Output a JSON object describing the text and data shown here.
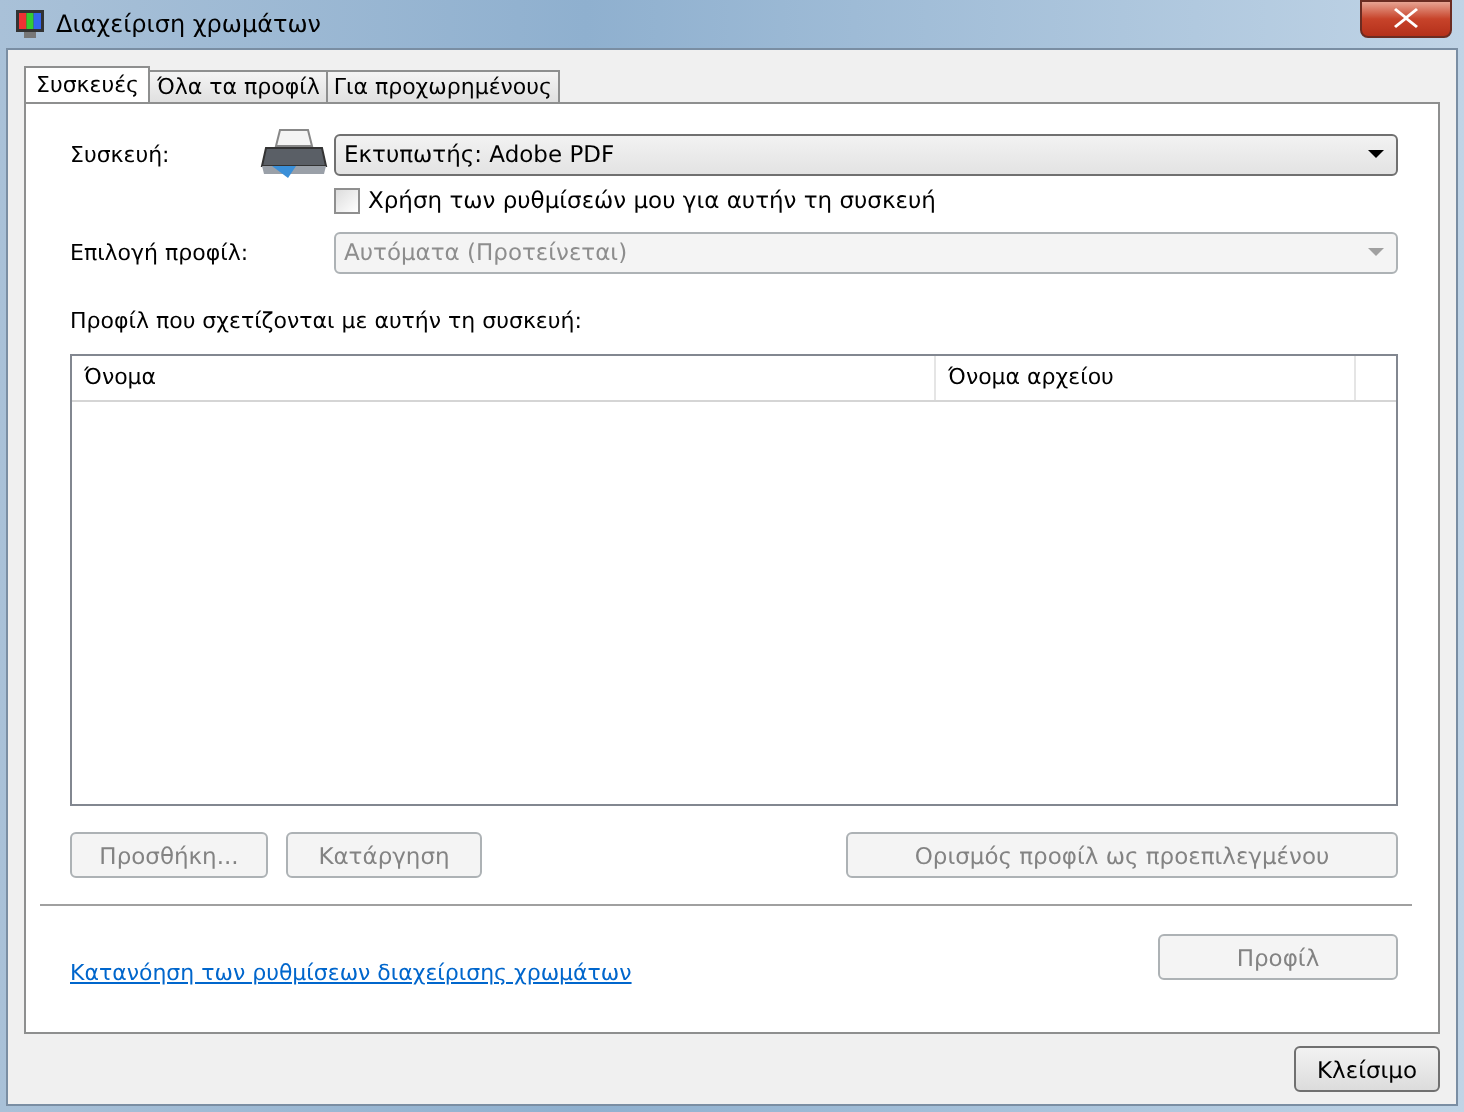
{
  "window": {
    "title": "Διαχείριση χρωμάτων"
  },
  "tabs": [
    {
      "label": "Συσκευές",
      "selected": true
    },
    {
      "label": "Όλα τα προφίλ",
      "selected": false
    },
    {
      "label": "Για προχωρημένους",
      "selected": false
    }
  ],
  "device": {
    "label": "Συσκευή:",
    "value": "Εκτυπωτής: Adobe PDF",
    "disabled": false
  },
  "use_my_settings": {
    "label": "Χρήση των ρυθμίσεών μου για αυτήν τη συσκευή",
    "checked": false
  },
  "profile_selection": {
    "label": "Επιλογή προφίλ:",
    "value": "Αυτόματα (Προτείνεται)",
    "disabled": true
  },
  "profiles": {
    "label": "Προφίλ που σχετίζονται με αυτήν τη συσκευή:",
    "columns": [
      "Όνομα",
      "Όνομα αρχείου"
    ]
  },
  "list_buttons": [
    {
      "label": "Προσθήκη...",
      "disabled": true
    },
    {
      "label": "Κατάργηση",
      "disabled": true
    },
    {
      "label": "Ορισμός προφίλ ως προεπιλεγμένου",
      "disabled": true
    }
  ],
  "link": "Κατανόηση των ρυθμίσεων διαχείρισης χρωμάτων",
  "profile_button": {
    "label": "Προφίλ",
    "disabled": true
  },
  "close_button": {
    "label": "Κλείσιμο",
    "disabled": false
  }
}
